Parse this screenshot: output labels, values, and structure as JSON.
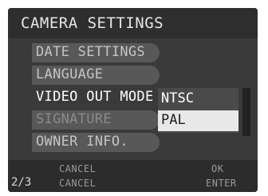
{
  "title": "CAMERA SETTINGS",
  "menu": {
    "items": [
      {
        "label": "DATE SETTINGS",
        "state": "normal"
      },
      {
        "label": "LANGUAGE",
        "state": "normal"
      },
      {
        "label": "VIDEO OUT MODE",
        "state": "selected"
      },
      {
        "label": "SIGNATURE",
        "state": "dim"
      },
      {
        "label": "OWNER INFO.",
        "state": "normal"
      }
    ]
  },
  "dropdown": {
    "options": [
      "NTSC",
      "PAL"
    ],
    "selected": "PAL"
  },
  "footer": {
    "page": "2/3",
    "cancel_top": "CANCEL",
    "cancel_bottom": "CANCEL",
    "ok_label": "OK",
    "enter_label": "ENTER"
  },
  "colors": {
    "screen_bg": "#3a3a3a",
    "item_bg": "#585858",
    "highlight": "#e8e8e8"
  }
}
